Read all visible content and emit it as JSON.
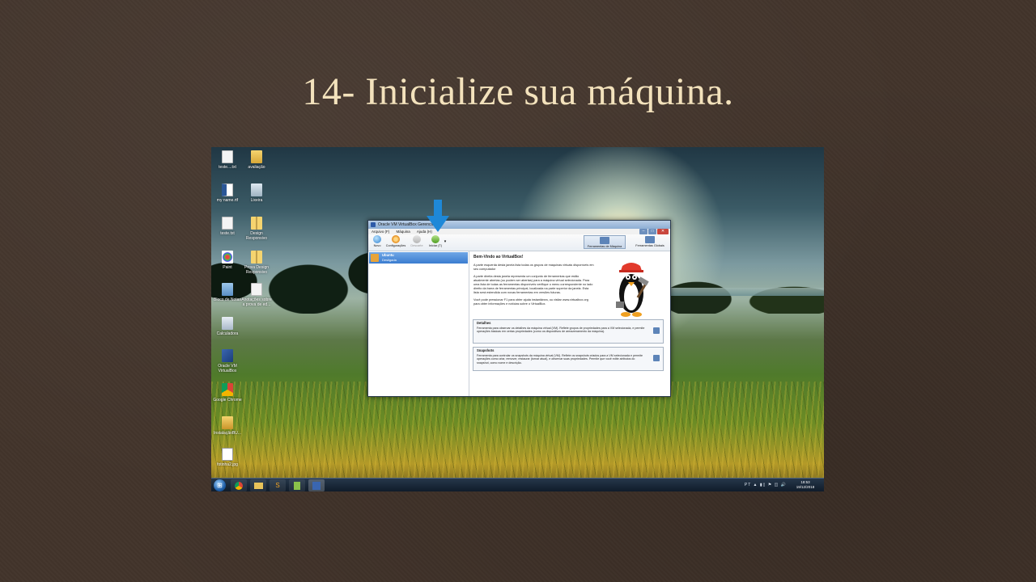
{
  "slide": {
    "title": "14-  Inicialize sua máquina."
  },
  "desktop": {
    "icons": [
      {
        "label": "teste....txt",
        "glyph": "doc-icon"
      },
      {
        "label": "avaliação",
        "glyph": "folder-icon"
      },
      {
        "label": "my name.rtf",
        "glyph": "word-icon"
      },
      {
        "label": "Lixeira",
        "glyph": "trash-icon"
      },
      {
        "label": "teste.txt",
        "glyph": "doc-icon"
      },
      {
        "label": "Design Responsivo",
        "glyph": "zip-icon"
      },
      {
        "label": "Paint",
        "glyph": "paint-icon"
      },
      {
        "label": "Prova Design Responsivo",
        "glyph": "zip-icon"
      },
      {
        "label": "Bloco de Notas",
        "glyph": "notepad-icon"
      },
      {
        "label": "Anotações sobre a prova de ed...",
        "glyph": "doc-icon"
      },
      {
        "label": "Calculadora",
        "glyph": "calculator-icon"
      },
      {
        "label": "Oracle VM VirtualBox",
        "glyph": "virtualbox-icon"
      },
      {
        "label": "Google Chrome",
        "glyph": "chrome-icon"
      },
      {
        "label": "InstalaçãoBU...",
        "glyph": "install-icon"
      },
      {
        "label": "fotinha2.jpg",
        "glyph": "image-icon"
      }
    ]
  },
  "taskbar": {
    "start": "⊞",
    "items": [
      "chrome",
      "explorer",
      "sublime",
      "notepad++",
      "virtualbox"
    ],
    "tray": "PT  ▲  ▮▯  ⚑  ◫  🔊",
    "time": "18:53",
    "date": "19/12/2018"
  },
  "vbox": {
    "title": "Oracle VM VirtualBox Gerenciador",
    "menu": [
      "Arquivo (F)",
      "Máquina",
      "Ajuda (H)"
    ],
    "toolbar": {
      "new": "Novo",
      "settings": "Configurações",
      "discard": "Descarte",
      "start": "Iniciar (T)",
      "machine_tools": "Ferramentas de Máquina",
      "global_tools": "Ferramentas Globais"
    },
    "vm": {
      "name": "Ubuntu",
      "state": "Desligada"
    },
    "welcome": {
      "heading": "Bem-Vindo ao VirtualBox!",
      "p1": "A parte esquerda desta janela lista todas os grupos de máquinas virtuais disponíveis em seu computador",
      "p2": "A parte direita desta janela representa um conjunto de ferramentas que estão atualmente abertas (ou podem ser abertas) para a máquina virtual selecionada. Para uma lista de todas as ferramentas disponíveis verifique o menu correspondente no lado direito da barra de ferramentas principal, localizada na parte superior da janela. Esta lista será estendida com novas ferramentas em versões futuras.",
      "p3": "Você pode pressionar F1 para obter ajuda instantânea, ou visitar www.virtualbox.org para obter informações e notícias sobre o VirtualBox."
    },
    "details": {
      "title": "Detalhes",
      "desc": "Ferramenta para observar os detalhes da máquina virtual (VM). Reflete grupos de propriedades para a VM selecionada, e permite operações básicas em certas propriedades (como os dispositivos de armazenamento da máquina)."
    },
    "snapshots": {
      "title": "Snapshots",
      "desc": "Ferramenta para controlar os snapshots da máquina virtual (VM). Reflete os snapshots criados para a VM selecionada e permite operações como criar, remover, restaurar (tornar atual), e observar suas propriedades. Permite que você edite atributos do snapshot, como nome e descrição."
    }
  },
  "colors": {
    "title": "#f3e2bc",
    "background": "#42342b",
    "accent_arrow": "#1e88d8"
  }
}
